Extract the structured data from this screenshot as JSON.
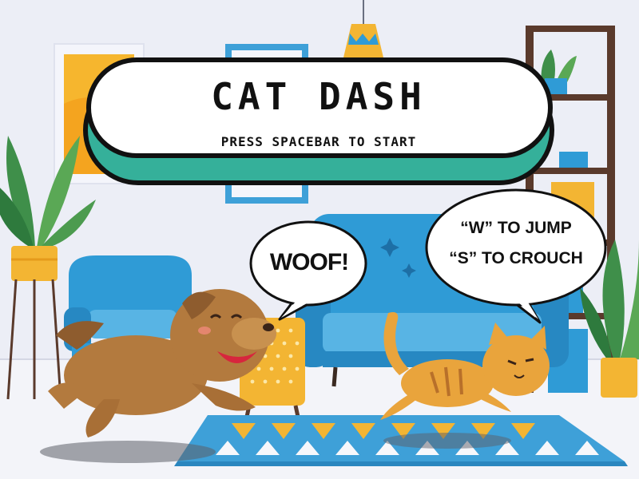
{
  "game": {
    "title": "CAT DASH",
    "prompt": "PRESS SPACEBAR TO START"
  },
  "dog_speech": "WOOF!",
  "controls": {
    "jump": "“W”  TO JUMP",
    "crouch": "“S” TO CROUCH"
  },
  "colors": {
    "wall": "#eceef6",
    "sofa": "#2f9bd6",
    "title_panel_accent": "#35b09a",
    "dog": "#b37a3e",
    "cat": "#e9a43c",
    "ottoman": "#f3b533"
  },
  "icons": [
    "speech-bubble",
    "dog",
    "cat",
    "sofa",
    "armchair",
    "plant",
    "shelf",
    "lamp",
    "rug"
  ]
}
